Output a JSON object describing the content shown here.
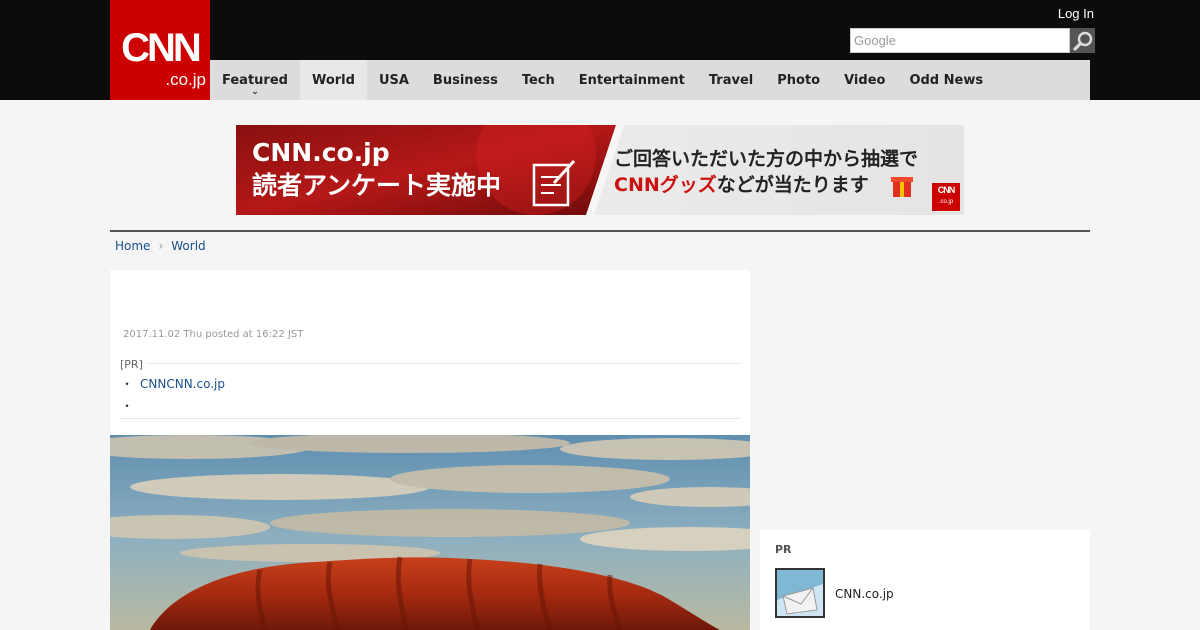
{
  "header": {
    "logo_top": "CNN",
    "logo_bottom": ".co.jp",
    "login": "Log In",
    "search_placeholder": "Google"
  },
  "nav": {
    "items": [
      "Featured",
      "World",
      "USA",
      "Business",
      "Tech",
      "Entertainment",
      "Travel",
      "Photo",
      "Video",
      "Odd News"
    ],
    "active": "World"
  },
  "banner": {
    "title_line1": "CNN.co.jp",
    "title_line2": "読者アンケート実施中",
    "text_line1": "ご回答いただいた方の中から抽選で",
    "text_line2_red": "CNNグッズ",
    "text_line2_rest": "などが当たります",
    "badge_top": "CNN",
    "badge_bottom": ".co.jp"
  },
  "breadcrumb": {
    "home": "Home",
    "section": "World"
  },
  "article": {
    "posted": "2017.11.02 Thu posted at 16:22 JST",
    "pr_label": "[PR]",
    "pr_bullet": "・",
    "pr_link": "CNNCNN.co.jp",
    "pr_bullet2": "・"
  },
  "sidebar": {
    "pr_label": "PR",
    "pr_title": "CNN.co.jp"
  },
  "colors": {
    "brand_red": "#cc0000",
    "top_bar": "#0c0c0c",
    "nav_bg": "#dcdcdc",
    "link": "#1a4e8a"
  }
}
